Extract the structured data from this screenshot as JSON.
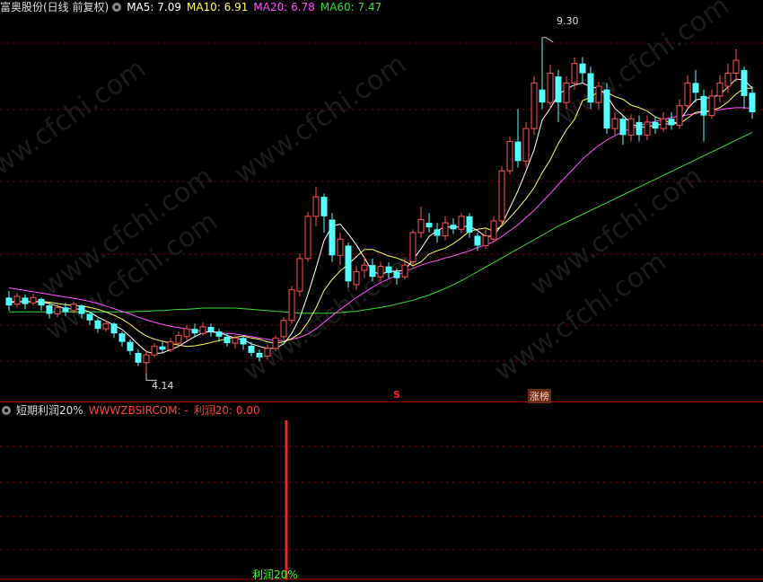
{
  "main_header": {
    "title": "富奥股份(日线 前复权)",
    "ma5": "MA5: 7.09",
    "ma10": "MA10: 6.91",
    "ma20": "MA20: 6.78",
    "ma60": "MA60: 7.47"
  },
  "sub_header": {
    "title": "短期利润20%",
    "formula": "WWWZBSIRCOM: -",
    "profit": "利润20: 0.00"
  },
  "annotations": {
    "high_label": "9.30",
    "low_label": "4.14",
    "marker_s": "S",
    "marker_zhangting": "涨榜",
    "profit_label": "利润20%"
  },
  "watermark": "www.cfchi.com",
  "colors": {
    "background": "#000000",
    "grid": "#7a0000",
    "up": "#ff5050",
    "down": "#54ffff",
    "ma5": "#ffffff",
    "ma10": "#ffff55",
    "ma20": "#ff50ff",
    "ma60": "#33dd33",
    "signal": "#ff2020"
  },
  "chart_data": {
    "type": "candlestick",
    "y_range": [
      3.8,
      9.6
    ],
    "candles": [
      {
        "o": 5.3,
        "c": 5.18,
        "h": 5.4,
        "l": 5.1
      },
      {
        "o": 5.2,
        "c": 5.32,
        "h": 5.38,
        "l": 5.15
      },
      {
        "o": 5.3,
        "c": 5.2,
        "h": 5.35,
        "l": 5.12
      },
      {
        "o": 5.22,
        "c": 5.3,
        "h": 5.36,
        "l": 5.18
      },
      {
        "o": 5.28,
        "c": 5.18,
        "h": 5.3,
        "l": 5.1
      },
      {
        "o": 5.18,
        "c": 5.05,
        "h": 5.22,
        "l": 4.98
      },
      {
        "o": 5.05,
        "c": 5.15,
        "h": 5.2,
        "l": 5.0
      },
      {
        "o": 5.15,
        "c": 5.08,
        "h": 5.22,
        "l": 5.02
      },
      {
        "o": 5.1,
        "c": 5.2,
        "h": 5.24,
        "l": 5.06
      },
      {
        "o": 5.18,
        "c": 5.05,
        "h": 5.2,
        "l": 4.98
      },
      {
        "o": 5.05,
        "c": 4.95,
        "h": 5.08,
        "l": 4.88
      },
      {
        "o": 4.95,
        "c": 4.82,
        "h": 4.98,
        "l": 4.76
      },
      {
        "o": 4.82,
        "c": 4.9,
        "h": 4.95,
        "l": 4.78
      },
      {
        "o": 4.9,
        "c": 4.75,
        "h": 4.92,
        "l": 4.68
      },
      {
        "o": 4.75,
        "c": 4.62,
        "h": 4.78,
        "l": 4.55
      },
      {
        "o": 4.62,
        "c": 4.48,
        "h": 4.66,
        "l": 4.42
      },
      {
        "o": 4.45,
        "c": 4.3,
        "h": 4.5,
        "l": 4.25
      },
      {
        "o": 4.3,
        "c": 4.42,
        "h": 4.48,
        "l": 4.14
      },
      {
        "o": 4.42,
        "c": 4.55,
        "h": 4.6,
        "l": 4.38
      },
      {
        "o": 4.55,
        "c": 4.5,
        "h": 4.62,
        "l": 4.45
      },
      {
        "o": 4.5,
        "c": 4.62,
        "h": 4.68,
        "l": 4.46
      },
      {
        "o": 4.6,
        "c": 4.72,
        "h": 4.78,
        "l": 4.55
      },
      {
        "o": 4.7,
        "c": 4.82,
        "h": 4.88,
        "l": 4.65
      },
      {
        "o": 4.82,
        "c": 4.75,
        "h": 4.9,
        "l": 4.7
      },
      {
        "o": 4.75,
        "c": 4.85,
        "h": 4.92,
        "l": 4.72
      },
      {
        "o": 4.85,
        "c": 4.78,
        "h": 4.9,
        "l": 4.7
      },
      {
        "o": 4.78,
        "c": 4.7,
        "h": 4.82,
        "l": 4.62
      },
      {
        "o": 4.7,
        "c": 4.6,
        "h": 4.75,
        "l": 4.55
      },
      {
        "o": 4.6,
        "c": 4.68,
        "h": 4.72,
        "l": 4.52
      },
      {
        "o": 4.68,
        "c": 4.58,
        "h": 4.72,
        "l": 4.5
      },
      {
        "o": 4.56,
        "c": 4.45,
        "h": 4.62,
        "l": 4.4
      },
      {
        "o": 4.45,
        "c": 4.38,
        "h": 4.5,
        "l": 4.32
      },
      {
        "o": 4.4,
        "c": 4.52,
        "h": 4.58,
        "l": 4.36
      },
      {
        "o": 4.52,
        "c": 4.68,
        "h": 4.72,
        "l": 4.48
      },
      {
        "o": 4.7,
        "c": 4.95,
        "h": 5.0,
        "l": 4.66
      },
      {
        "o": 4.95,
        "c": 5.42,
        "h": 5.48,
        "l": 4.9
      },
      {
        "o": 5.4,
        "c": 5.9,
        "h": 5.98,
        "l": 5.32
      },
      {
        "o": 5.9,
        "c": 6.55,
        "h": 6.62,
        "l": 5.85
      },
      {
        "o": 6.55,
        "c": 6.85,
        "h": 7.0,
        "l": 6.4
      },
      {
        "o": 6.85,
        "c": 6.55,
        "h": 6.9,
        "l": 6.3
      },
      {
        "o": 6.5,
        "c": 5.95,
        "h": 6.6,
        "l": 5.85
      },
      {
        "o": 5.95,
        "c": 6.2,
        "h": 6.3,
        "l": 5.8
      },
      {
        "o": 6.1,
        "c": 5.55,
        "h": 6.15,
        "l": 5.45
      },
      {
        "o": 5.5,
        "c": 5.7,
        "h": 5.78,
        "l": 5.42
      },
      {
        "o": 5.72,
        "c": 5.8,
        "h": 5.92,
        "l": 5.6
      },
      {
        "o": 5.8,
        "c": 5.62,
        "h": 5.9,
        "l": 5.55
      },
      {
        "o": 5.62,
        "c": 5.78,
        "h": 5.85,
        "l": 5.55
      },
      {
        "o": 5.78,
        "c": 5.68,
        "h": 5.84,
        "l": 5.6
      },
      {
        "o": 5.7,
        "c": 5.6,
        "h": 5.75,
        "l": 5.5
      },
      {
        "o": 5.62,
        "c": 5.8,
        "h": 5.9,
        "l": 5.58
      },
      {
        "o": 5.85,
        "c": 6.3,
        "h": 6.35,
        "l": 5.8
      },
      {
        "o": 6.3,
        "c": 6.5,
        "h": 6.7,
        "l": 6.22
      },
      {
        "o": 6.45,
        "c": 6.38,
        "h": 6.6,
        "l": 6.3
      },
      {
        "o": 6.35,
        "c": 6.25,
        "h": 6.45,
        "l": 6.15
      },
      {
        "o": 6.25,
        "c": 6.45,
        "h": 6.55,
        "l": 6.18
      },
      {
        "o": 6.42,
        "c": 6.35,
        "h": 6.52,
        "l": 6.28
      },
      {
        "o": 6.35,
        "c": 6.55,
        "h": 6.6,
        "l": 6.3
      },
      {
        "o": 6.55,
        "c": 6.3,
        "h": 6.6,
        "l": 6.22
      },
      {
        "o": 6.25,
        "c": 6.1,
        "h": 6.3,
        "l": 6.02
      },
      {
        "o": 6.1,
        "c": 6.25,
        "h": 6.35,
        "l": 6.05
      },
      {
        "o": 6.2,
        "c": 6.48,
        "h": 6.55,
        "l": 6.15
      },
      {
        "o": 6.48,
        "c": 7.25,
        "h": 7.32,
        "l": 6.4
      },
      {
        "o": 7.25,
        "c": 7.7,
        "h": 7.78,
        "l": 7.2
      },
      {
        "o": 7.7,
        "c": 7.4,
        "h": 8.2,
        "l": 7.3
      },
      {
        "o": 7.4,
        "c": 7.9,
        "h": 8.0,
        "l": 7.3
      },
      {
        "o": 7.9,
        "c": 8.6,
        "h": 8.7,
        "l": 7.8
      },
      {
        "o": 8.5,
        "c": 8.3,
        "h": 9.3,
        "l": 8.2
      },
      {
        "o": 8.3,
        "c": 8.75,
        "h": 8.88,
        "l": 8.2
      },
      {
        "o": 8.7,
        "c": 8.3,
        "h": 8.8,
        "l": 8.0
      },
      {
        "o": 8.3,
        "c": 8.6,
        "h": 8.7,
        "l": 8.2
      },
      {
        "o": 8.6,
        "c": 8.9,
        "h": 9.0,
        "l": 8.5
      },
      {
        "o": 8.9,
        "c": 8.75,
        "h": 9.0,
        "l": 8.6
      },
      {
        "o": 8.75,
        "c": 8.3,
        "h": 8.85,
        "l": 8.2
      },
      {
        "o": 8.3,
        "c": 8.55,
        "h": 8.62,
        "l": 8.2
      },
      {
        "o": 8.5,
        "c": 7.9,
        "h": 8.6,
        "l": 7.82
      },
      {
        "o": 7.9,
        "c": 8.05,
        "h": 8.15,
        "l": 7.8
      },
      {
        "o": 8.05,
        "c": 7.8,
        "h": 8.1,
        "l": 7.65
      },
      {
        "o": 7.8,
        "c": 8.05,
        "h": 8.12,
        "l": 7.7
      },
      {
        "o": 8.0,
        "c": 7.8,
        "h": 8.1,
        "l": 7.7
      },
      {
        "o": 7.8,
        "c": 8.0,
        "h": 8.1,
        "l": 7.72
      },
      {
        "o": 8.0,
        "c": 7.9,
        "h": 8.08,
        "l": 7.82
      },
      {
        "o": 7.9,
        "c": 8.05,
        "h": 8.15,
        "l": 7.85
      },
      {
        "o": 8.05,
        "c": 7.95,
        "h": 8.15,
        "l": 7.88
      },
      {
        "o": 7.95,
        "c": 8.25,
        "h": 8.35,
        "l": 7.9
      },
      {
        "o": 8.25,
        "c": 8.6,
        "h": 8.72,
        "l": 8.2
      },
      {
        "o": 8.6,
        "c": 8.45,
        "h": 8.8,
        "l": 8.3
      },
      {
        "o": 8.4,
        "c": 8.1,
        "h": 8.5,
        "l": 7.7
      },
      {
        "o": 8.1,
        "c": 8.4,
        "h": 8.5,
        "l": 8.05
      },
      {
        "o": 8.4,
        "c": 8.6,
        "h": 8.72,
        "l": 8.3
      },
      {
        "o": 8.55,
        "c": 8.75,
        "h": 8.9,
        "l": 8.45
      },
      {
        "o": 8.75,
        "c": 8.95,
        "h": 9.12,
        "l": 8.62
      },
      {
        "o": 8.8,
        "c": 8.4,
        "h": 8.85,
        "l": 8.2
      },
      {
        "o": 8.45,
        "c": 8.15,
        "h": 8.55,
        "l": 8.05
      }
    ],
    "ma5": [
      5.22,
      5.24,
      5.23,
      5.24,
      5.23,
      5.21,
      5.17,
      5.13,
      5.13,
      5.12,
      5.08,
      5.0,
      4.94,
      4.88,
      4.81,
      4.7,
      4.58,
      4.47,
      4.44,
      4.45,
      4.5,
      4.55,
      4.63,
      4.7,
      4.76,
      4.78,
      4.76,
      4.72,
      4.68,
      4.65,
      4.59,
      4.55,
      4.52,
      4.52,
      4.59,
      4.75,
      4.99,
      5.35,
      5.75,
      6.18,
      6.4,
      6.43,
      6.28,
      6.11,
      5.91,
      5.7,
      5.66,
      5.7,
      5.71,
      5.72,
      5.88,
      6.05,
      6.24,
      6.33,
      6.39,
      6.38,
      6.39,
      6.4,
      6.33,
      6.24,
      6.25,
      6.42,
      6.68,
      6.94,
      7.25,
      7.57,
      8.03,
      8.21,
      8.42,
      8.51,
      8.57,
      8.6,
      8.54,
      8.52,
      8.41,
      8.21,
      8.1,
      7.98,
      7.92,
      7.93,
      7.95,
      7.97,
      7.97,
      8.01,
      8.2,
      8.34,
      8.36,
      8.38,
      8.42,
      8.54,
      8.66,
      8.65,
      8.52
    ],
    "ma10": [
      5.24,
      5.24,
      5.24,
      5.24,
      5.24,
      5.23,
      5.21,
      5.19,
      5.18,
      5.17,
      5.15,
      5.12,
      5.08,
      5.03,
      4.97,
      4.89,
      4.79,
      4.71,
      4.66,
      4.63,
      4.6,
      4.57,
      4.55,
      4.56,
      4.58,
      4.61,
      4.64,
      4.67,
      4.69,
      4.71,
      4.68,
      4.66,
      4.62,
      4.6,
      4.62,
      4.67,
      4.75,
      4.92,
      5.14,
      5.41,
      5.58,
      5.71,
      5.81,
      5.93,
      6.04,
      6.04,
      5.99,
      5.94,
      5.91,
      5.86,
      5.79,
      5.85,
      5.97,
      6.02,
      6.06,
      6.13,
      6.22,
      6.32,
      6.35,
      6.37,
      6.32,
      6.4,
      6.53,
      6.67,
      6.82,
      6.99,
      7.22,
      7.42,
      7.67,
      7.88,
      8.04,
      8.33,
      8.38,
      8.47,
      8.46,
      8.39,
      8.35,
      8.26,
      8.22,
      8.17,
      8.08,
      8.03,
      7.98,
      7.97,
      8.06,
      8.15,
      8.16,
      8.18,
      8.22,
      8.31,
      8.43,
      8.52,
      8.52
    ],
    "ma20": [
      5.45,
      5.43,
      5.41,
      5.39,
      5.37,
      5.35,
      5.33,
      5.31,
      5.29,
      5.27,
      5.24,
      5.21,
      5.17,
      5.13,
      5.09,
      5.05,
      5.0,
      4.96,
      4.92,
      4.89,
      4.86,
      4.84,
      4.82,
      4.8,
      4.78,
      4.77,
      4.76,
      4.75,
      4.74,
      4.72,
      4.7,
      4.68,
      4.66,
      4.64,
      4.64,
      4.66,
      4.69,
      4.74,
      4.82,
      4.92,
      5.02,
      5.12,
      5.21,
      5.3,
      5.38,
      5.46,
      5.53,
      5.59,
      5.64,
      5.7,
      5.75,
      5.8,
      5.84,
      5.87,
      5.91,
      5.94,
      5.98,
      6.02,
      6.07,
      6.11,
      6.16,
      6.24,
      6.33,
      6.42,
      6.53,
      6.64,
      6.77,
      6.9,
      7.04,
      7.17,
      7.3,
      7.43,
      7.54,
      7.64,
      7.72,
      7.79,
      7.85,
      7.9,
      7.94,
      7.98,
      8.01,
      8.04,
      8.07,
      8.09,
      8.11,
      8.13,
      8.15,
      8.17,
      8.19,
      8.21,
      8.22,
      8.22,
      8.21
    ],
    "ma60": [
      5.08,
      5.08,
      5.08,
      5.08,
      5.08,
      5.08,
      5.08,
      5.08,
      5.08,
      5.08,
      5.08,
      5.08,
      5.08,
      5.08,
      5.08,
      5.08,
      5.09,
      5.09,
      5.1,
      5.1,
      5.11,
      5.12,
      5.12,
      5.13,
      5.14,
      5.14,
      5.14,
      5.14,
      5.14,
      5.13,
      5.12,
      5.11,
      5.1,
      5.09,
      5.08,
      5.07,
      5.06,
      5.06,
      5.06,
      5.06,
      5.06,
      5.07,
      5.08,
      5.09,
      5.11,
      5.13,
      5.15,
      5.17,
      5.2,
      5.23,
      5.26,
      5.3,
      5.34,
      5.39,
      5.44,
      5.5,
      5.56,
      5.63,
      5.7,
      5.77,
      5.84,
      5.91,
      5.98,
      6.05,
      6.12,
      6.19,
      6.26,
      6.33,
      6.4,
      6.46,
      6.52,
      6.58,
      6.64,
      6.7,
      6.76,
      6.82,
      6.88,
      6.94,
      7.0,
      7.06,
      7.12,
      7.18,
      7.24,
      7.3,
      7.36,
      7.42,
      7.48,
      7.54,
      7.6,
      7.66,
      7.72,
      7.78,
      7.84
    ],
    "signal": {
      "index": 34,
      "value": 20
    }
  }
}
